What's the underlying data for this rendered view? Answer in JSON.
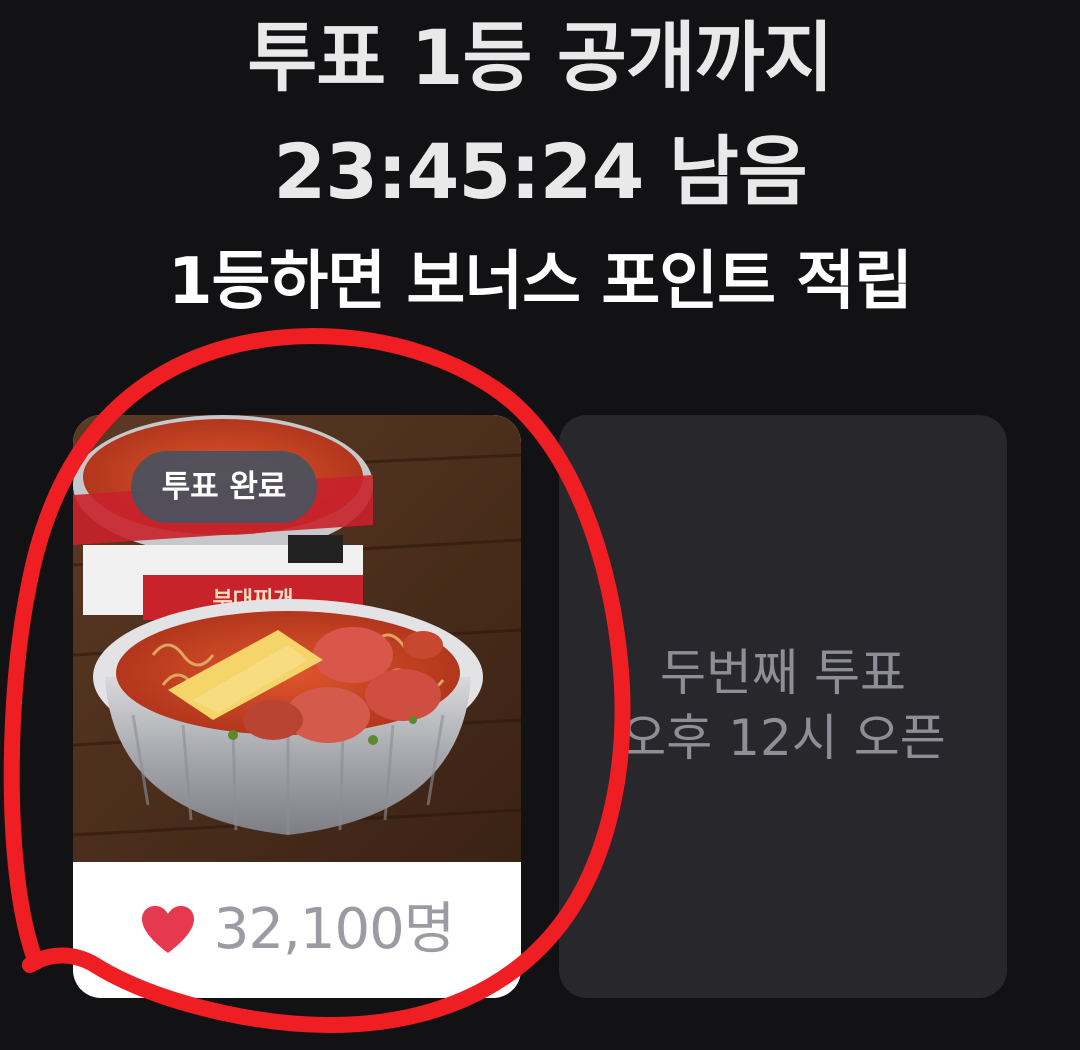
{
  "header": {
    "title_line1": "투표 1등 공개까지",
    "title_line2": "23:45:24 남음",
    "subtitle": "1등하면 보너스 포인트 적립"
  },
  "vote_card": {
    "badge": "투표 완료",
    "count": "32,100명",
    "heart_color": "#e5394f"
  },
  "next_vote_card": {
    "line1": "두번째 투표",
    "line2": "오후 12시 오픈"
  },
  "annotation_color": "#ee1e22"
}
